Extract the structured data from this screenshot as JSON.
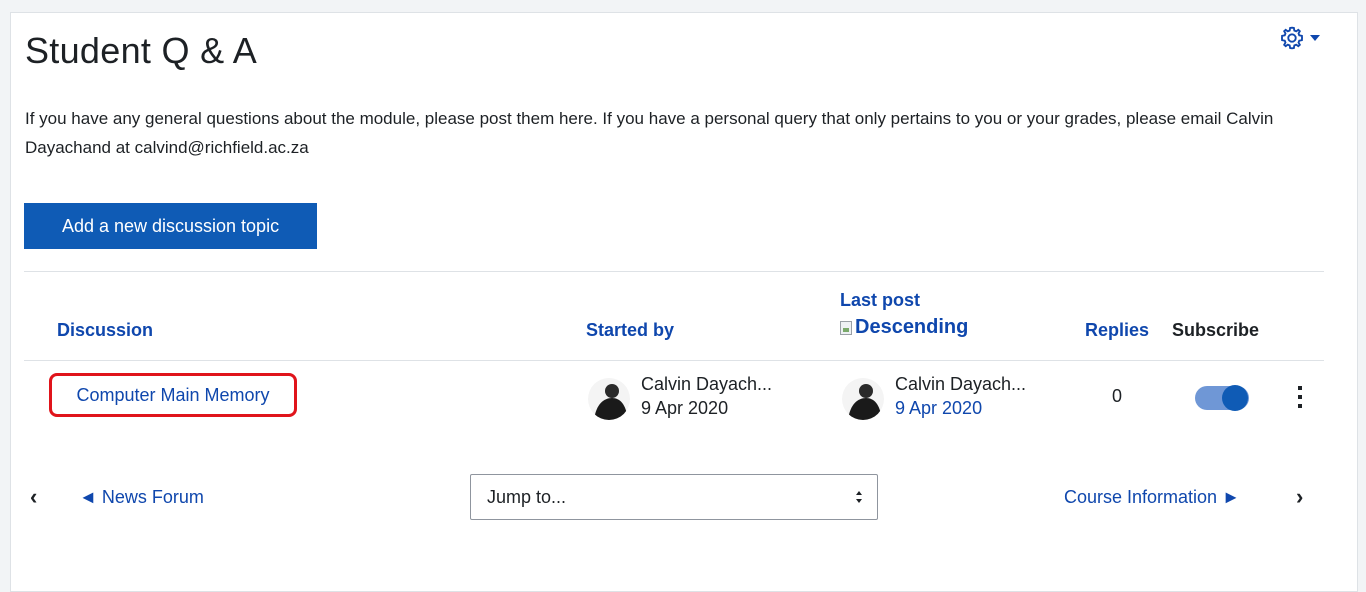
{
  "page": {
    "title": "Student Q & A",
    "intro": "If you have any general questions about the module, please post them here. If you have a personal query that only pertains to you or your grades, please email Calvin Dayachand at calvind@richfield.ac.za",
    "add_button": "Add a new discussion topic"
  },
  "table": {
    "headers": {
      "discussion": "Discussion",
      "started_by": "Started by",
      "last_post": "Last post",
      "sort_alt": "Descending",
      "replies": "Replies",
      "subscribe": "Subscribe"
    },
    "rows": [
      {
        "topic": "Computer Main Memory",
        "started_by": "Calvin Dayach...",
        "started_date": "9 Apr 2020",
        "last_post_by": "Calvin Dayach...",
        "last_post_date": "9 Apr 2020",
        "replies": "0",
        "subscribed": true
      }
    ]
  },
  "nav": {
    "prev": "◄ News Forum",
    "jump_to": "Jump to...",
    "next": "Course Information ►"
  },
  "colors": {
    "accent": "#0f5bb5",
    "link": "#0f47ad",
    "highlight": "#e0141b"
  }
}
